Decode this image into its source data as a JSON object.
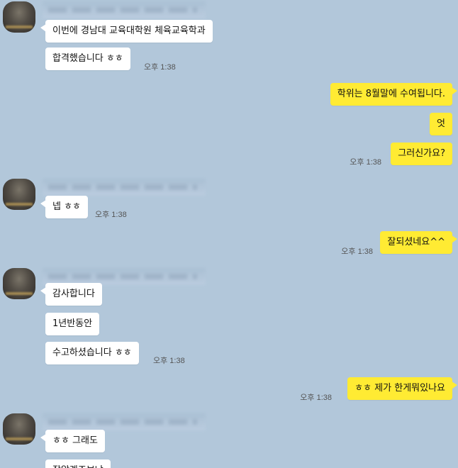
{
  "messages": [
    {
      "text": "이번에 경남대 교육대학원 체육교육학과"
    },
    {
      "text": "합격했습니다 ㅎㅎ",
      "time": "오후 1:38"
    },
    {
      "text": "학위는 8월말에 수여됩니다."
    },
    {
      "text": "엇"
    },
    {
      "text": "그러신가요?",
      "time": "오후 1:38"
    },
    {
      "text": "넵 ㅎㅎ",
      "time": "오후 1:38"
    },
    {
      "text": "잘되셨네요^^",
      "time": "오후 1:38"
    },
    {
      "text": "감사합니다"
    },
    {
      "text": "1년반동안"
    },
    {
      "text": "수고하셨습니다 ㅎㅎ",
      "time": "오후 1:38"
    },
    {
      "text": "ㅎㅎ 제가 한게뭐있나요",
      "time": "오후 1:38"
    },
    {
      "text": "ㅎㅎ 그래도"
    },
    {
      "text": "잘알겠죠보냐"
    }
  ]
}
